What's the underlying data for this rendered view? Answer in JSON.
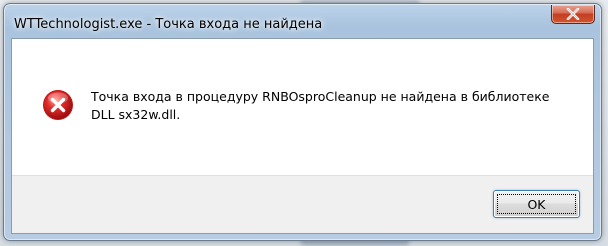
{
  "window": {
    "title": "WTTechnologist.exe - Точка входа не найдена",
    "close_icon": "close-icon"
  },
  "message": {
    "icon": "error-icon",
    "text": "Точка входа в процедуру RNBOsproCleanup не найдена в библиотеке DLL sx32w.dll."
  },
  "buttons": {
    "ok_label": "OK"
  },
  "colors": {
    "close_button": "#c94a2e",
    "error_icon": "#d42323",
    "ok_border": "#3c7fb1"
  }
}
